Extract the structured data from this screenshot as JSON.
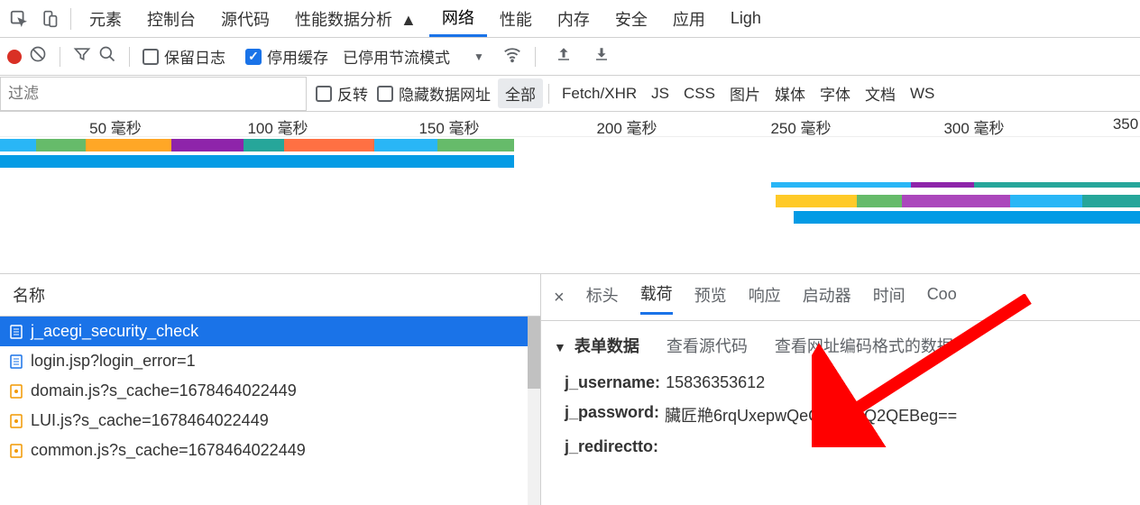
{
  "tabs": {
    "elements": "元素",
    "console": "控制台",
    "sources": "源代码",
    "performance_insights": "性能数据分析",
    "network": "网络",
    "performance": "性能",
    "memory": "内存",
    "security": "安全",
    "application": "应用",
    "lighthouse": "Ligh"
  },
  "toolbar": {
    "preserve_log": "保留日志",
    "disable_cache": "停用缓存",
    "throttle_mode": "已停用节流模式"
  },
  "filter": {
    "placeholder": "过滤",
    "invert": "反转",
    "hide_data_urls": "隐藏数据网址",
    "types": {
      "all": "全部",
      "fetch_xhr": "Fetch/XHR",
      "js": "JS",
      "css": "CSS",
      "img": "图片",
      "media": "媒体",
      "font": "字体",
      "doc": "文档",
      "ws": "WS"
    }
  },
  "timeline": {
    "t50": "50 毫秒",
    "t100": "100 毫秒",
    "t150": "150 毫秒",
    "t200": "200 毫秒",
    "t250": "250 毫秒",
    "t300": "300 毫秒",
    "t350": "350"
  },
  "requests": {
    "header": "名称",
    "items": [
      "j_acegi_security_check",
      "login.jsp?login_error=1",
      "domain.js?s_cache=1678464022449",
      "LUI.js?s_cache=1678464022449",
      "common.js?s_cache=1678464022449"
    ]
  },
  "detail_tabs": {
    "headers": "标头",
    "payload": "载荷",
    "preview": "预览",
    "response": "响应",
    "initiator": "启动器",
    "timing": "时间",
    "cookies": "Coo"
  },
  "form_section": {
    "title": "表单数据",
    "view_source": "查看源代码",
    "view_url_encoded": "查看网址编码格式的数据",
    "fields": [
      {
        "key": "j_username:",
        "value": "15836353612"
      },
      {
        "key": "j_password:",
        "value": "臟匠艵6rqUxepwQeGQEgVQ2QEBeg=="
      },
      {
        "key": "j_redirectto:",
        "value": ""
      }
    ]
  }
}
